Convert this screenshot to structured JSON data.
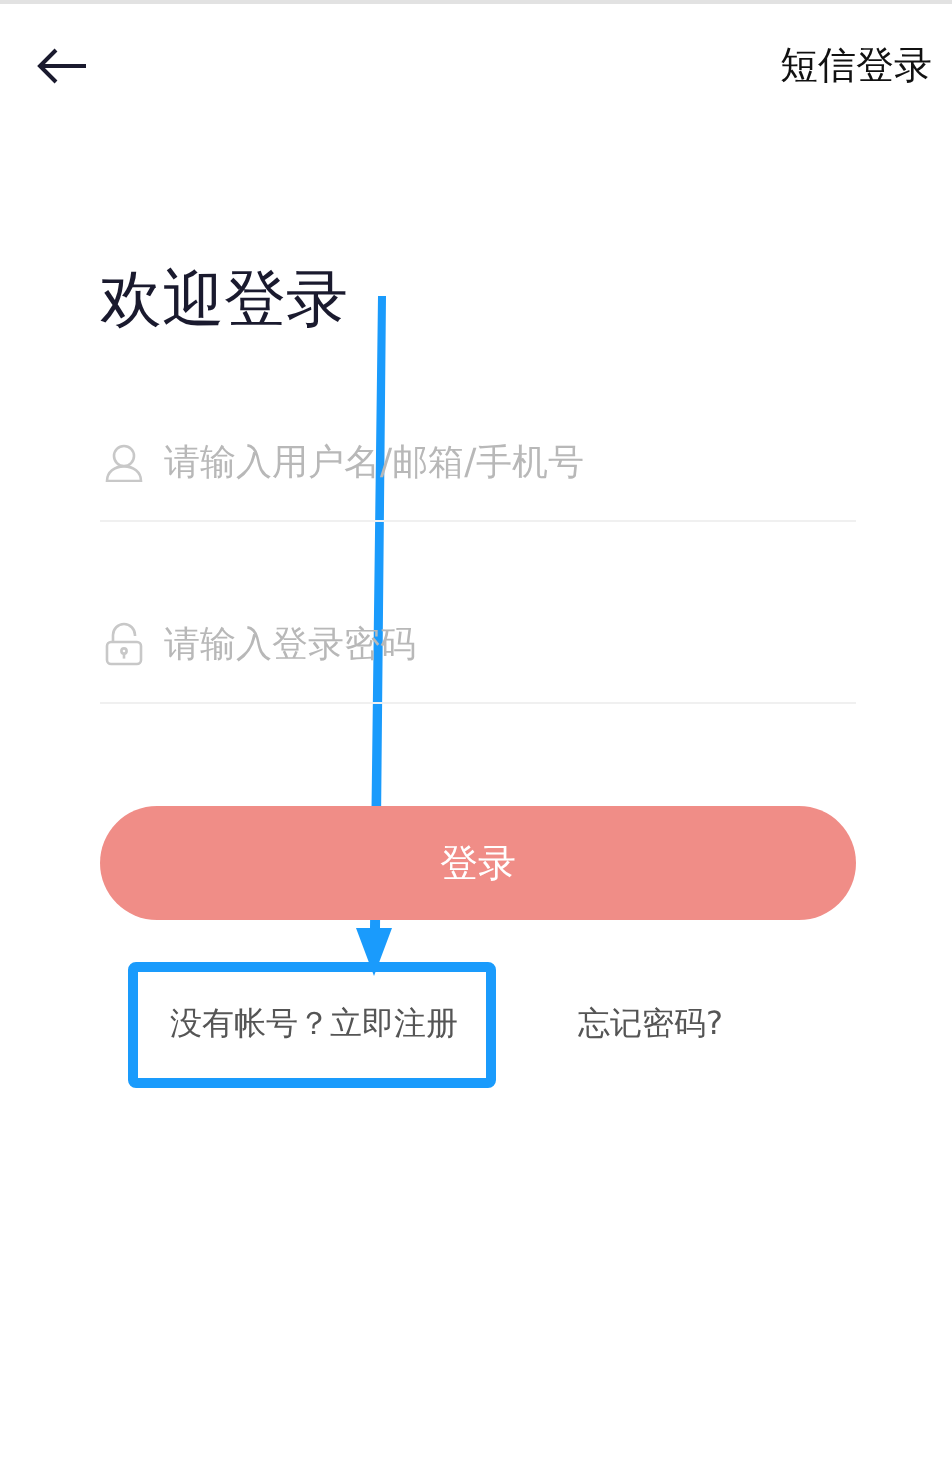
{
  "header": {
    "sms_login": "短信登录"
  },
  "title": "欢迎登录",
  "fields": [
    {
      "kind": "user",
      "placeholder": "请输入用户名/邮箱/手机号"
    },
    {
      "kind": "password",
      "placeholder": "请输入登录密码"
    }
  ],
  "login_button": "登录",
  "links": [
    {
      "label": "没有帐号？立即注册",
      "highlighted": true
    },
    {
      "label": "忘记密码?",
      "highlighted": false
    }
  ]
}
